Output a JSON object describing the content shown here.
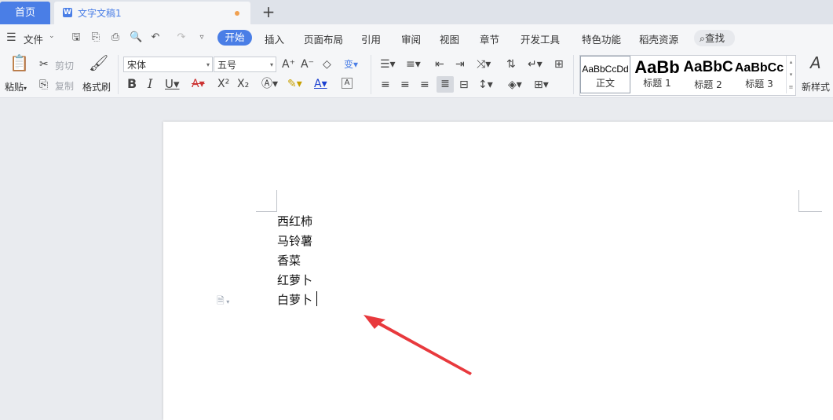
{
  "tabs": {
    "home": "首页",
    "doc_title": "文字文稿1",
    "new_tab": "+"
  },
  "menu": {
    "file": "文件",
    "items": [
      "开始",
      "插入",
      "页面布局",
      "引用",
      "审阅",
      "视图",
      "章节",
      "开发工具",
      "特色功能",
      "稻壳资源"
    ],
    "search": "查找"
  },
  "ribbon": {
    "paste": "粘贴",
    "cut": "剪切",
    "copy": "复制",
    "format_painter": "格式刷",
    "font_name": "宋体",
    "font_size": "五号",
    "styles": [
      {
        "preview": "AaBbCcDd",
        "name": "正文"
      },
      {
        "preview": "AaBb",
        "name": "标题 1"
      },
      {
        "preview": "AaBbC",
        "name": "标题 2"
      },
      {
        "preview": "AaBbCc",
        "name": "标题 3"
      }
    ],
    "new_style": "新样式"
  },
  "document": {
    "lines": [
      "西红柿",
      "马铃薯",
      "香菜",
      "红萝卜",
      "白萝卜"
    ]
  },
  "colors": {
    "accent": "#4a7ee6",
    "annotation_arrow": "#e8393d"
  }
}
